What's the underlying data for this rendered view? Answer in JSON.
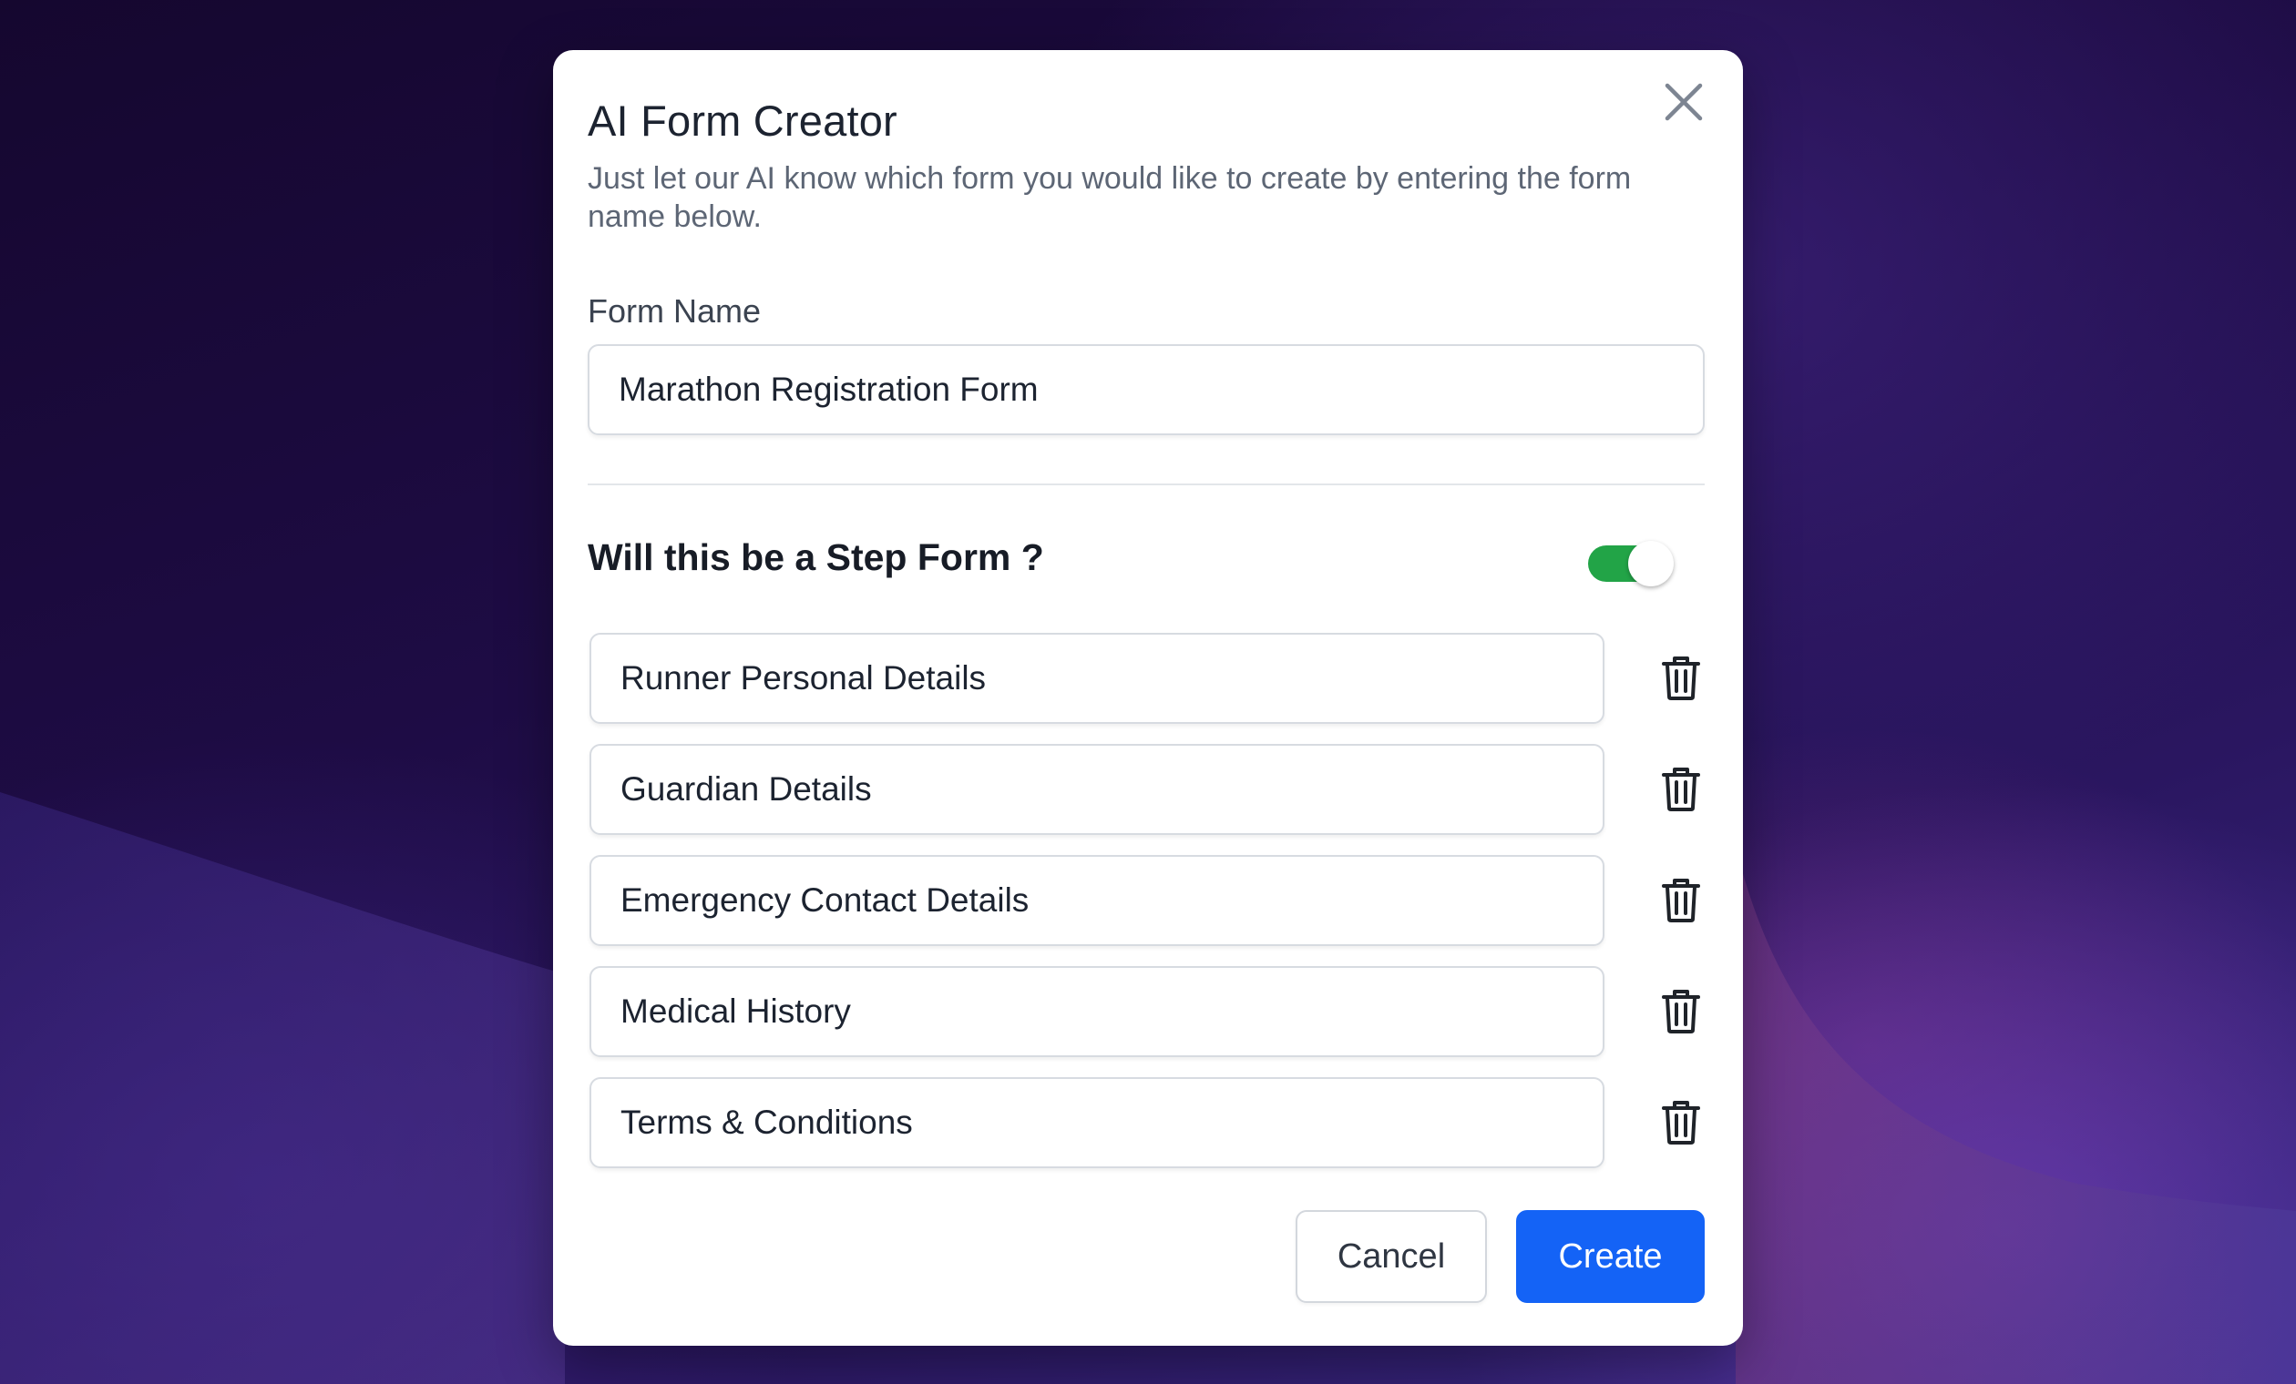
{
  "modal": {
    "title": "AI Form Creator",
    "subtitle": "Just let our AI know which form you would like to create by entering the form name below.",
    "close_icon": "close-icon"
  },
  "form_name": {
    "label": "Form Name",
    "value": "Marathon Registration Form"
  },
  "step_form": {
    "question": "Will this be a Step Form ?",
    "enabled": true,
    "toggle_color": "#22a447"
  },
  "steps": [
    {
      "value": "Runner Personal Details",
      "delete_icon": "trash-icon"
    },
    {
      "value": "Guardian Details",
      "delete_icon": "trash-icon"
    },
    {
      "value": "Emergency Contact Details",
      "delete_icon": "trash-icon"
    },
    {
      "value": "Medical History",
      "delete_icon": "trash-icon"
    },
    {
      "value": "Terms & Conditions",
      "delete_icon": "trash-icon"
    }
  ],
  "actions": {
    "cancel_label": "Cancel",
    "create_label": "Create",
    "create_color": "#1463f6"
  }
}
